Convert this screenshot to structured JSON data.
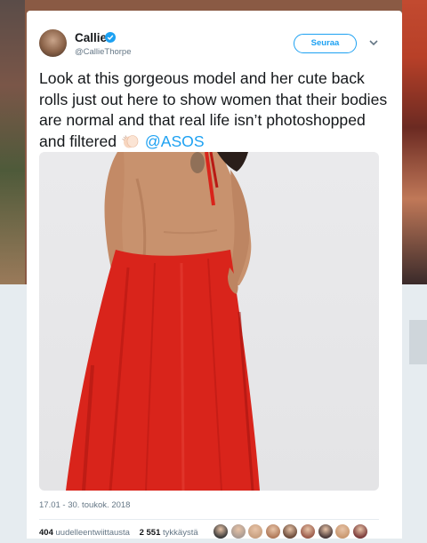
{
  "tweet": {
    "display_name": "Callie",
    "handle": "@CallieThorpe",
    "follow_label": "Seuraa",
    "text": "Look at this gorgeous model and her cute back rolls just out here to show women that their bodies are normal and that real life isn’t photoshopped and filtered",
    "emoji": "clapping-hands-emoji",
    "mention": "@ASOS",
    "timestamp": "17.01 - 30. toukok. 2018",
    "retweets_count": "404",
    "retweets_label": "uudelleentwiittausta",
    "likes_count": "2 551",
    "likes_label": "tykkäystä",
    "liker_avatar_colors": [
      "#3a3a3a",
      "#a89a92",
      "#c8a080",
      "#b07a5a",
      "#6a4a3a",
      "#9a5a4a",
      "#4a3a3a",
      "#c99870",
      "#7a3a3a"
    ]
  },
  "colors": {
    "accent": "#1da1f2",
    "dress": "#d9241b",
    "skin": "#c8926e"
  }
}
